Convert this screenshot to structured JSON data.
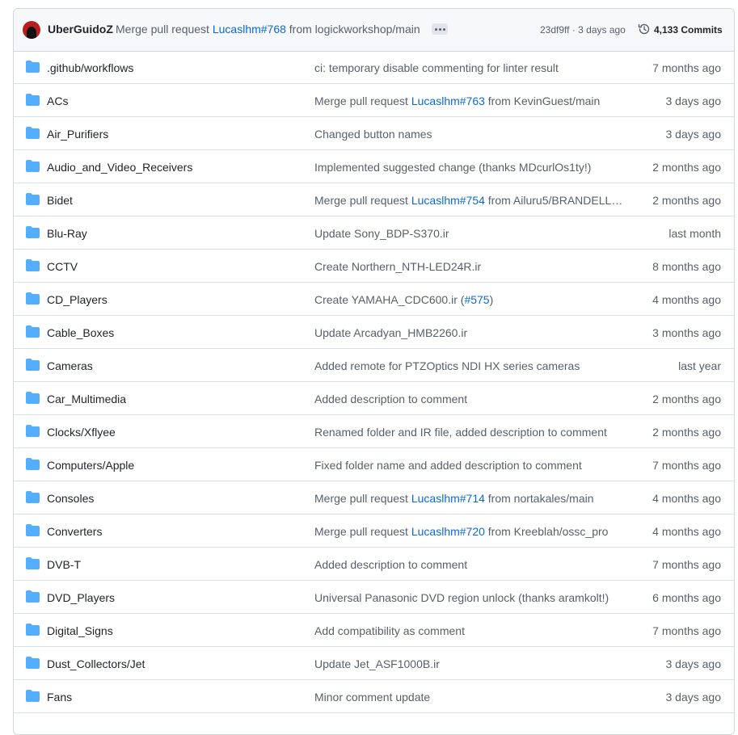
{
  "header": {
    "author": "UberGuidoZ",
    "commit_prefix": "Merge pull request",
    "commit_link": "Lucaslhm#768",
    "commit_suffix": "from logickworkshop/main",
    "sha_time": "23df9ff · 3 days ago",
    "commits": "4,133 Commits"
  },
  "icons": {
    "folder": "folder-icon",
    "history": "history-icon",
    "ellipsis": "ellipsis-icon"
  },
  "colors": {
    "folder": "#54aeff",
    "link": "#0969da",
    "muted": "#57606a"
  },
  "rows": [
    {
      "name": ".github/workflows",
      "msg_pre": "ci: temporary disable commenting for linter result",
      "link": "",
      "msg_post": "",
      "age": "7 months ago"
    },
    {
      "name": "ACs",
      "msg_pre": "Merge pull request ",
      "link": "Lucaslhm#763",
      "msg_post": " from KevinGuest/main",
      "age": "3 days ago"
    },
    {
      "name": "Air_Purifiers",
      "msg_pre": "Changed button names",
      "link": "",
      "msg_post": "",
      "age": "3 days ago"
    },
    {
      "name": "Audio_and_Video_Receivers",
      "msg_pre": "Implemented suggested change (thanks MDcurlOs1ty!)",
      "link": "",
      "msg_post": "",
      "age": "2 months ago"
    },
    {
      "name": "Bidet",
      "msg_pre": "Merge pull request ",
      "link": "Lucaslhm#754",
      "msg_post": " from Ailuru5/BRANDELL_…",
      "age": "2 months ago"
    },
    {
      "name": "Blu-Ray",
      "msg_pre": "Update Sony_BDP-S370.ir",
      "link": "",
      "msg_post": "",
      "age": "last month"
    },
    {
      "name": "CCTV",
      "msg_pre": "Create Northern_NTH-LED24R.ir",
      "link": "",
      "msg_post": "",
      "age": "8 months ago"
    },
    {
      "name": "CD_Players",
      "msg_pre": "Create YAMAHA_CDC600.ir (",
      "link": "#575",
      "msg_post": ")",
      "age": "4 months ago"
    },
    {
      "name": "Cable_Boxes",
      "msg_pre": "Update Arcadyan_HMB2260.ir",
      "link": "",
      "msg_post": "",
      "age": "3 months ago"
    },
    {
      "name": "Cameras",
      "msg_pre": "Added remote for PTZOptics NDI HX series cameras",
      "link": "",
      "msg_post": "",
      "age": "last year"
    },
    {
      "name": "Car_Multimedia",
      "msg_pre": "Added description to comment",
      "link": "",
      "msg_post": "",
      "age": "2 months ago"
    },
    {
      "name": "Clocks/Xflyee",
      "msg_pre": "Renamed folder and IR file, added description to comment",
      "link": "",
      "msg_post": "",
      "age": "2 months ago"
    },
    {
      "name": "Computers/Apple",
      "msg_pre": "Fixed folder name and added description to comment",
      "link": "",
      "msg_post": "",
      "age": "7 months ago"
    },
    {
      "name": "Consoles",
      "msg_pre": "Merge pull request ",
      "link": "Lucaslhm#714",
      "msg_post": " from nortakales/main",
      "age": "4 months ago"
    },
    {
      "name": "Converters",
      "msg_pre": "Merge pull request ",
      "link": "Lucaslhm#720",
      "msg_post": " from Kreeblah/ossc_pro",
      "age": "4 months ago"
    },
    {
      "name": "DVB-T",
      "msg_pre": "Added description to comment",
      "link": "",
      "msg_post": "",
      "age": "7 months ago"
    },
    {
      "name": "DVD_Players",
      "msg_pre": "Universal Panasonic DVD region unlock (thanks aramkolt!)",
      "link": "",
      "msg_post": "",
      "age": "6 months ago"
    },
    {
      "name": "Digital_Signs",
      "msg_pre": "Add compatibility as comment",
      "link": "",
      "msg_post": "",
      "age": "7 months ago"
    },
    {
      "name": "Dust_Collectors/Jet",
      "msg_pre": "Update Jet_ASF1000B.ir",
      "link": "",
      "msg_post": "",
      "age": "3 days ago"
    },
    {
      "name": "Fans",
      "msg_pre": "Minor comment update",
      "link": "",
      "msg_post": "",
      "age": "3 days ago"
    }
  ]
}
